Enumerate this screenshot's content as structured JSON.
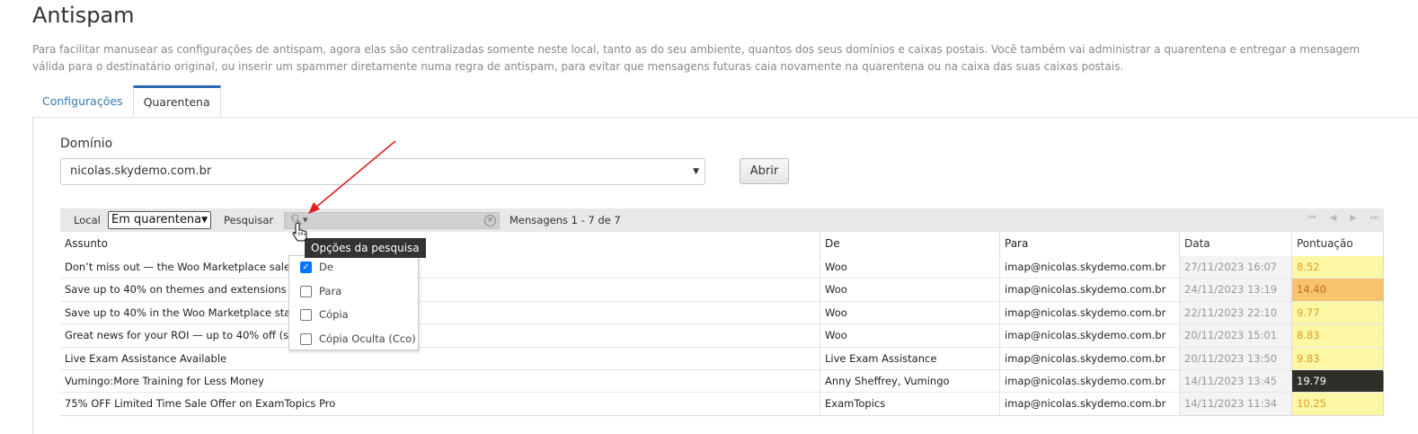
{
  "page": {
    "title": "Antispam",
    "description": "Para facilitar manusear as configurações de antispam, agora elas são centralizadas somente neste local, tanto as do seu ambiente, quantos dos seus domínios e caixas postais. Você também vai administrar a quarentena e entregar a mensagem válida para o destinatário original, ou inserir um spammer diretamente numa regra de antispam, para evitar que mensagens futuras caia novamente na quarentena ou na caixa das suas caixas postais."
  },
  "tabs": [
    {
      "label": "Configurações",
      "active": false
    },
    {
      "label": "Quarentena",
      "active": true
    }
  ],
  "domain": {
    "label": "Domínio",
    "value": "nicolas.skydemo.com.br",
    "open_button": "Abrir"
  },
  "toolbar": {
    "local_label": "Local",
    "local_value": "Em quarentena",
    "search_label": "Pesquisar",
    "search_value": "",
    "count_text": "Mensagens 1 - 7 de 7"
  },
  "tooltip": "Opções da pesquisa",
  "search_options": [
    {
      "label": "De",
      "checked": true
    },
    {
      "label": "Para",
      "checked": false
    },
    {
      "label": "Cópia",
      "checked": false
    },
    {
      "label": "Cópia Oculta (Cco)",
      "checked": false
    }
  ],
  "grid": {
    "columns": [
      "Assunto",
      "De",
      "Para",
      "Data",
      "Pontuação"
    ],
    "rows": [
      {
        "subject": "Don’t miss out — the Woo Marketplace sale e",
        "from": "Woo",
        "to": "imap@nicolas.skydemo.com.br",
        "date": "27/11/2023 16:07",
        "score": "8.52",
        "level": "yellow"
      },
      {
        "subject": "Save up to 40% on themes and extensions",
        "from": "Woo",
        "to": "imap@nicolas.skydemo.com.br",
        "date": "24/11/2023 13:19",
        "score": "14.40",
        "level": "orange"
      },
      {
        "subject": "Save up to 40% in the Woo Marketplace start",
        "from": "Woo",
        "to": "imap@nicolas.skydemo.com.br",
        "date": "22/11/2023 22:10",
        "score": "9.77",
        "level": "yellow"
      },
      {
        "subject": "Great news for your ROI — up to 40% off (st",
        "from": "Woo",
        "to": "imap@nicolas.skydemo.com.br",
        "date": "20/11/2023 15:01",
        "score": "8.83",
        "level": "yellow"
      },
      {
        "subject": "Live Exam Assistance Available",
        "from": "Live Exam Assistance",
        "to": "imap@nicolas.skydemo.com.br",
        "date": "20/11/2023 13:50",
        "score": "9.83",
        "level": "yellow"
      },
      {
        "subject": "Vumingo:More Training for Less Money",
        "from": "Anny Sheffrey, Vumingo",
        "to": "imap@nicolas.skydemo.com.br",
        "date": "14/11/2023 13:45",
        "score": "19.79",
        "level": "dark"
      },
      {
        "subject": "75% OFF Limited Time Sale Offer on ExamTopics Pro",
        "from": "ExamTopics",
        "to": "imap@nicolas.skydemo.com.br",
        "date": "14/11/2023 11:34",
        "score": "10.25",
        "level": "yellow"
      }
    ]
  },
  "colors": {
    "accent": "#2a6bb0",
    "link": "#337ab7",
    "score_low": "#fbf7a5",
    "score_mid": "#f8c46b",
    "score_high": "#2f2f2a",
    "annotation_arrow": "#e02020"
  }
}
